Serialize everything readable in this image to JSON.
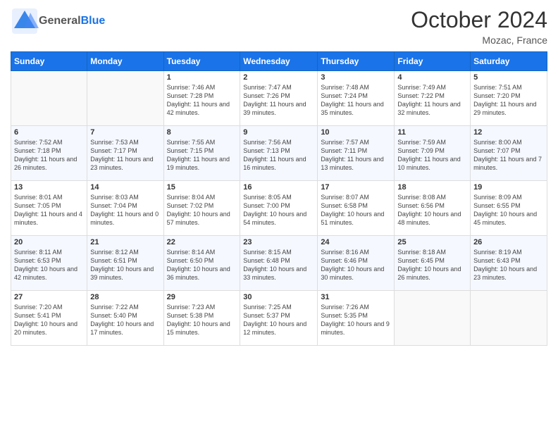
{
  "header": {
    "logo": {
      "general": "General",
      "blue": "Blue"
    },
    "title": "October 2024",
    "location": "Mozac, France"
  },
  "weekdays": [
    "Sunday",
    "Monday",
    "Tuesday",
    "Wednesday",
    "Thursday",
    "Friday",
    "Saturday"
  ],
  "weeks": [
    [
      {
        "day": "",
        "info": ""
      },
      {
        "day": "",
        "info": ""
      },
      {
        "day": "1",
        "info": "Sunrise: 7:46 AM\nSunset: 7:28 PM\nDaylight: 11 hours and 42 minutes."
      },
      {
        "day": "2",
        "info": "Sunrise: 7:47 AM\nSunset: 7:26 PM\nDaylight: 11 hours and 39 minutes."
      },
      {
        "day": "3",
        "info": "Sunrise: 7:48 AM\nSunset: 7:24 PM\nDaylight: 11 hours and 35 minutes."
      },
      {
        "day": "4",
        "info": "Sunrise: 7:49 AM\nSunset: 7:22 PM\nDaylight: 11 hours and 32 minutes."
      },
      {
        "day": "5",
        "info": "Sunrise: 7:51 AM\nSunset: 7:20 PM\nDaylight: 11 hours and 29 minutes."
      }
    ],
    [
      {
        "day": "6",
        "info": "Sunrise: 7:52 AM\nSunset: 7:18 PM\nDaylight: 11 hours and 26 minutes."
      },
      {
        "day": "7",
        "info": "Sunrise: 7:53 AM\nSunset: 7:17 PM\nDaylight: 11 hours and 23 minutes."
      },
      {
        "day": "8",
        "info": "Sunrise: 7:55 AM\nSunset: 7:15 PM\nDaylight: 11 hours and 19 minutes."
      },
      {
        "day": "9",
        "info": "Sunrise: 7:56 AM\nSunset: 7:13 PM\nDaylight: 11 hours and 16 minutes."
      },
      {
        "day": "10",
        "info": "Sunrise: 7:57 AM\nSunset: 7:11 PM\nDaylight: 11 hours and 13 minutes."
      },
      {
        "day": "11",
        "info": "Sunrise: 7:59 AM\nSunset: 7:09 PM\nDaylight: 11 hours and 10 minutes."
      },
      {
        "day": "12",
        "info": "Sunrise: 8:00 AM\nSunset: 7:07 PM\nDaylight: 11 hours and 7 minutes."
      }
    ],
    [
      {
        "day": "13",
        "info": "Sunrise: 8:01 AM\nSunset: 7:05 PM\nDaylight: 11 hours and 4 minutes."
      },
      {
        "day": "14",
        "info": "Sunrise: 8:03 AM\nSunset: 7:04 PM\nDaylight: 11 hours and 0 minutes."
      },
      {
        "day": "15",
        "info": "Sunrise: 8:04 AM\nSunset: 7:02 PM\nDaylight: 10 hours and 57 minutes."
      },
      {
        "day": "16",
        "info": "Sunrise: 8:05 AM\nSunset: 7:00 PM\nDaylight: 10 hours and 54 minutes."
      },
      {
        "day": "17",
        "info": "Sunrise: 8:07 AM\nSunset: 6:58 PM\nDaylight: 10 hours and 51 minutes."
      },
      {
        "day": "18",
        "info": "Sunrise: 8:08 AM\nSunset: 6:56 PM\nDaylight: 10 hours and 48 minutes."
      },
      {
        "day": "19",
        "info": "Sunrise: 8:09 AM\nSunset: 6:55 PM\nDaylight: 10 hours and 45 minutes."
      }
    ],
    [
      {
        "day": "20",
        "info": "Sunrise: 8:11 AM\nSunset: 6:53 PM\nDaylight: 10 hours and 42 minutes."
      },
      {
        "day": "21",
        "info": "Sunrise: 8:12 AM\nSunset: 6:51 PM\nDaylight: 10 hours and 39 minutes."
      },
      {
        "day": "22",
        "info": "Sunrise: 8:14 AM\nSunset: 6:50 PM\nDaylight: 10 hours and 36 minutes."
      },
      {
        "day": "23",
        "info": "Sunrise: 8:15 AM\nSunset: 6:48 PM\nDaylight: 10 hours and 33 minutes."
      },
      {
        "day": "24",
        "info": "Sunrise: 8:16 AM\nSunset: 6:46 PM\nDaylight: 10 hours and 30 minutes."
      },
      {
        "day": "25",
        "info": "Sunrise: 8:18 AM\nSunset: 6:45 PM\nDaylight: 10 hours and 26 minutes."
      },
      {
        "day": "26",
        "info": "Sunrise: 8:19 AM\nSunset: 6:43 PM\nDaylight: 10 hours and 23 minutes."
      }
    ],
    [
      {
        "day": "27",
        "info": "Sunrise: 7:20 AM\nSunset: 5:41 PM\nDaylight: 10 hours and 20 minutes."
      },
      {
        "day": "28",
        "info": "Sunrise: 7:22 AM\nSunset: 5:40 PM\nDaylight: 10 hours and 17 minutes."
      },
      {
        "day": "29",
        "info": "Sunrise: 7:23 AM\nSunset: 5:38 PM\nDaylight: 10 hours and 15 minutes."
      },
      {
        "day": "30",
        "info": "Sunrise: 7:25 AM\nSunset: 5:37 PM\nDaylight: 10 hours and 12 minutes."
      },
      {
        "day": "31",
        "info": "Sunrise: 7:26 AM\nSunset: 5:35 PM\nDaylight: 10 hours and 9 minutes."
      },
      {
        "day": "",
        "info": ""
      },
      {
        "day": "",
        "info": ""
      }
    ]
  ]
}
